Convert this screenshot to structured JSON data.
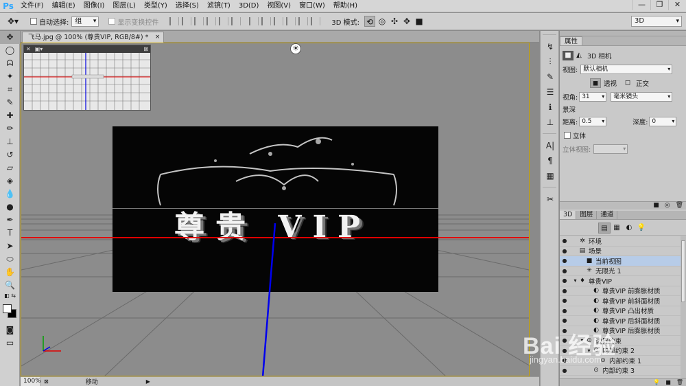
{
  "app": {
    "logo": "Ps"
  },
  "menu": [
    "文件(F)",
    "编辑(E)",
    "图像(I)",
    "图层(L)",
    "类型(Y)",
    "选择(S)",
    "滤镜(T)",
    "3D(D)",
    "视图(V)",
    "窗口(W)",
    "帮助(H)"
  ],
  "window_controls": {
    "minimize": "—",
    "restore": "❐",
    "close": "✕"
  },
  "options": {
    "auto_select_label": "自动选择:",
    "auto_select_value": "组",
    "show_transform_label": "显示变换控件",
    "mode_3d_label": "3D 模式:",
    "workspace": "3D"
  },
  "document": {
    "tab_title": "飞马.jpg @ 100% (尊贵VIP, RGB/8#) *",
    "tab_close": "×",
    "content_text": "尊贵 VIP"
  },
  "status": {
    "zoom": "100%",
    "mode": "移动"
  },
  "properties": {
    "tabs": [
      "属性"
    ],
    "heading": "3D 相机",
    "view_label": "视图:",
    "view_value": "默认相机",
    "perspective_label": "透视",
    "ortho_label": "正交",
    "fov_label": "视角:",
    "fov_value": "31",
    "fov_unit": "毫米镜头",
    "dof_label": "景深",
    "distance_label": "距离:",
    "distance_value": "0.5",
    "depth_label": "深度:",
    "depth_value": "0",
    "stereo_label": "立体",
    "stereo_view_label": "立体视图:",
    "stereo_view_value": ""
  },
  "layers_panel": {
    "tabs": [
      "3D",
      "图层",
      "通道"
    ],
    "rows": [
      {
        "label": "环境",
        "indent": 0,
        "twirl": "",
        "icon": "✲",
        "selected": false
      },
      {
        "label": "场景",
        "indent": 0,
        "twirl": "",
        "icon": "▤",
        "selected": false
      },
      {
        "label": "当前视图",
        "indent": 1,
        "twirl": "",
        "icon": "■",
        "selected": true
      },
      {
        "label": "无限光 1",
        "indent": 1,
        "twirl": "",
        "icon": "✳",
        "selected": false
      },
      {
        "label": "尊贵VIP",
        "indent": 0,
        "twirl": "▾",
        "icon": "♦",
        "selected": false
      },
      {
        "label": "尊贵VIP 前膨胀材质",
        "indent": 2,
        "twirl": "",
        "icon": "◐",
        "selected": false
      },
      {
        "label": "尊贵VIP 前斜面材质",
        "indent": 2,
        "twirl": "",
        "icon": "◐",
        "selected": false
      },
      {
        "label": "尊贵VIP 凸出材质",
        "indent": 2,
        "twirl": "",
        "icon": "◐",
        "selected": false
      },
      {
        "label": "尊贵VIP 后斜面材质",
        "indent": 2,
        "twirl": "",
        "icon": "◐",
        "selected": false
      },
      {
        "label": "尊贵VIP 后膨胀材质",
        "indent": 2,
        "twirl": "",
        "icon": "◐",
        "selected": false
      },
      {
        "label": "边界约束",
        "indent": 1,
        "twirl": "▾",
        "icon": "⊙",
        "selected": false
      },
      {
        "label": "内部约束 2",
        "indent": 2,
        "twirl": "▾",
        "icon": "⊙",
        "selected": false
      },
      {
        "label": "内部约束 1",
        "indent": 3,
        "twirl": "",
        "icon": "⊙",
        "selected": false
      },
      {
        "label": "内部约束 3",
        "indent": 2,
        "twirl": "",
        "icon": "⊙",
        "selected": false
      }
    ]
  },
  "watermark": {
    "text": "Bai 经验",
    "sub": "jingyan.baidu.com"
  }
}
